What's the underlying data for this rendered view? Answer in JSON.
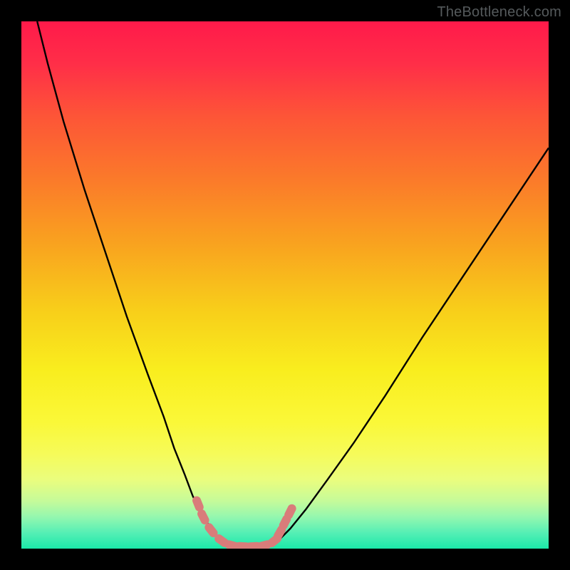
{
  "watermark": "TheBottleneck.com",
  "colors": {
    "frame": "#000000",
    "curve_stroke": "#000000",
    "marker_fill": "#d97c7a",
    "gradient_stops": [
      {
        "offset": 0.0,
        "color": "#ff1a4a"
      },
      {
        "offset": 0.08,
        "color": "#ff2e48"
      },
      {
        "offset": 0.18,
        "color": "#fd5537"
      },
      {
        "offset": 0.3,
        "color": "#fb7a2a"
      },
      {
        "offset": 0.42,
        "color": "#f9a21f"
      },
      {
        "offset": 0.55,
        "color": "#f8cf1a"
      },
      {
        "offset": 0.66,
        "color": "#f9ed1e"
      },
      {
        "offset": 0.76,
        "color": "#faf838"
      },
      {
        "offset": 0.82,
        "color": "#f6fb59"
      },
      {
        "offset": 0.87,
        "color": "#eafd7e"
      },
      {
        "offset": 0.91,
        "color": "#c5fb9a"
      },
      {
        "offset": 0.94,
        "color": "#94f7af"
      },
      {
        "offset": 0.97,
        "color": "#55efb5"
      },
      {
        "offset": 1.0,
        "color": "#1be8a9"
      }
    ]
  },
  "chart_data": {
    "type": "line",
    "title": "",
    "xlabel": "",
    "ylabel": "",
    "xlim": [
      0,
      100
    ],
    "ylim": [
      0,
      100
    ],
    "series": [
      {
        "name": "left-branch",
        "x": [
          3,
          5,
          8,
          12,
          16,
          20,
          24,
          27,
          29,
          31,
          32.5,
          34,
          35.5,
          37,
          38.5
        ],
        "y": [
          100,
          92,
          81,
          68,
          56,
          44,
          33,
          25,
          19,
          14,
          10,
          7,
          4.5,
          2.5,
          1
        ]
      },
      {
        "name": "valley-floor",
        "x": [
          38.5,
          40,
          42,
          44,
          46,
          47.5
        ],
        "y": [
          1,
          0.3,
          0.15,
          0.15,
          0.25,
          0.6
        ]
      },
      {
        "name": "right-branch",
        "x": [
          47.5,
          49,
          51,
          54,
          58,
          63,
          69,
          76,
          84,
          92,
          100
        ],
        "y": [
          0.6,
          1.8,
          3.8,
          7.5,
          13,
          20,
          29,
          40,
          52,
          64,
          76
        ]
      }
    ],
    "markers": {
      "name": "highlighted-points",
      "points": [
        {
          "x": 33.5,
          "y": 8.5
        },
        {
          "x": 34.5,
          "y": 6.0
        },
        {
          "x": 36.0,
          "y": 3.5
        },
        {
          "x": 38.0,
          "y": 1.5
        },
        {
          "x": 40.0,
          "y": 0.6
        },
        {
          "x": 42.0,
          "y": 0.4
        },
        {
          "x": 44.0,
          "y": 0.4
        },
        {
          "x": 46.0,
          "y": 0.6
        },
        {
          "x": 48.0,
          "y": 1.5
        },
        {
          "x": 49.0,
          "y": 3.0
        },
        {
          "x": 50.0,
          "y": 5.0
        },
        {
          "x": 51.0,
          "y": 7.0
        }
      ]
    }
  }
}
